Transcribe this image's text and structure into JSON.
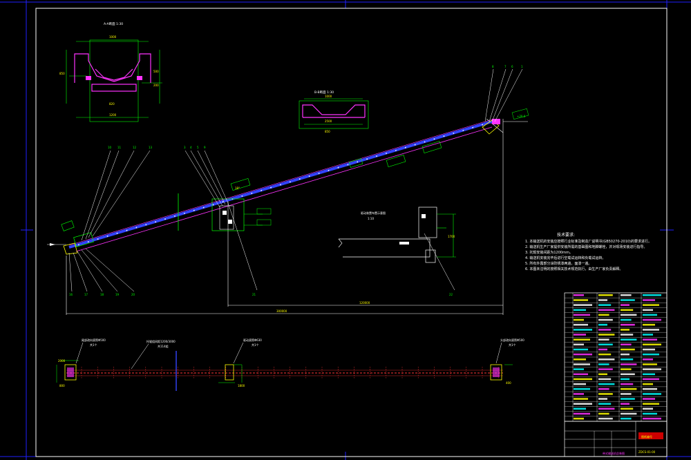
{
  "colors": {
    "background": "#000000",
    "frame": "#2020ff",
    "border": "#ffffff",
    "belt": "#3344ff",
    "structure": "#ff33ff",
    "dims": "#00ff00",
    "idler": "#ff3333",
    "yellow": "#ffff00",
    "cyan": "#00ffff",
    "stamp": "#ff0000"
  },
  "section_aa": {
    "title": "A-A断面 1:30",
    "dims": [
      "1000",
      "820",
      "1200",
      "850",
      "500",
      "200"
    ]
  },
  "section_bb": {
    "title": "B-B断面 1:30",
    "dims": [
      "1000",
      "2500",
      "850"
    ]
  },
  "head_labels": [
    "8",
    "7",
    "6",
    "1",
    "2"
  ],
  "tail_labels": [
    "10",
    "11",
    "12",
    "13",
    "14",
    "15"
  ],
  "tail_bottom_labels": [
    "16",
    "17",
    "18",
    "19",
    "20"
  ],
  "mid_labels": [
    "3",
    "4",
    "5",
    "9"
  ],
  "center_top_labels": [
    "21",
    "22",
    "23",
    "24"
  ],
  "drive_view": {
    "title": "驱动装置布置示意图",
    "scale": "1:10",
    "dim": "1700"
  },
  "dims_main": {
    "overall": "300000",
    "horizontal": "120000",
    "incline": "18°",
    "elev": "+20.0",
    "span1": "1530",
    "span2": "4000"
  },
  "bottom_view": {
    "callouts": [
      {
        "text": "尾部改向滚筒Φ500",
        "sub": "共1个"
      },
      {
        "text": "托辊组间距1200/3000",
        "sub": "共114组"
      },
      {
        "text": "驱动滚筒Φ630",
        "sub": "共1个"
      },
      {
        "text": "头部改向滚筒Φ500",
        "sub": "共1个"
      }
    ],
    "dims": [
      "2000",
      "800",
      "1800",
      "400"
    ]
  },
  "notes": {
    "title": "技术要求:",
    "lines": [
      "1. 本输送机的安装应按照行业标准及制造厂说明书(GB50270-2010)的要求进行。",
      "2. 输送机生产厂家提供安装所需的基础图和地脚螺栓，并对现场安装进行指导。",
      "3. 托辊安装间距为1200mm。",
      "4. 输送机安装完毕后进行空载试运转和负载试运转。",
      "5. 所有外露部分涂防锈漆两遍，面漆一遍。",
      "6. 本图未注明的按照相关技术规范执行，由生产厂家负责解释。"
    ]
  },
  "bom_rows": 26,
  "title_block": {
    "stamp": "图纸编号",
    "drawing_no": "ZDCS-01-00",
    "footer": "带式输送机总装图"
  }
}
